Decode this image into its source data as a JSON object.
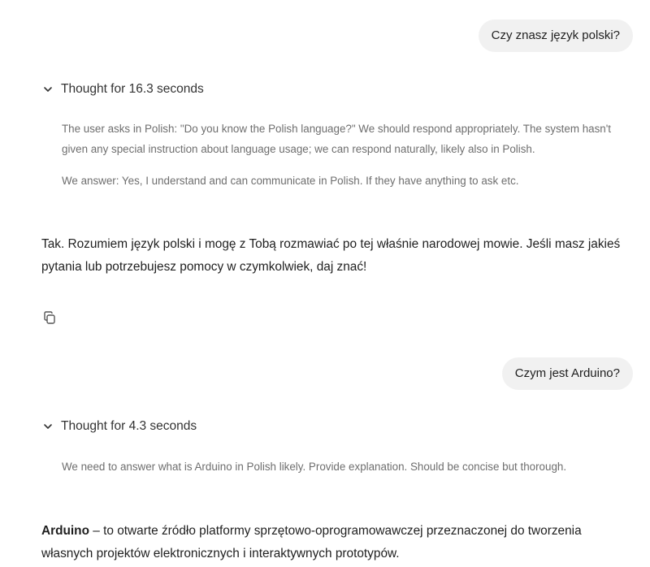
{
  "conversation": {
    "turn1": {
      "user_message": "Czy znasz język polski?",
      "thought_label": "Thought for 16.3 seconds",
      "thought_paragraphs": [
        "The user asks in Polish: \"Do you know the Polish language?\" We should respond appropriately. The system hasn't given any special instruction about language usage; we can respond naturally, likely also in Polish.",
        "We answer: Yes, I understand and can communicate in Polish. If they have anything to ask etc."
      ],
      "answer": "Tak. Rozumiem język polski i mogę z Tobą rozmawiać po tej właśnie narodowej mowie. Jeśli masz jakieś pytania lub potrzebujesz pomocy w czymkolwiek, daj znać!"
    },
    "turn2": {
      "user_message": "Czym jest Arduino?",
      "thought_label": "Thought for 4.3 seconds",
      "thought_paragraphs": [
        "We need to answer what is Arduino in Polish likely. Provide explanation. Should be concise but thorough."
      ],
      "answer_bold": "Arduino",
      "answer_rest": " – to otwarte źródło platformy sprzętowo-oprogramowawczej przeznaczonej do tworzenia własnych projektów elektronicznych i interaktywnych prototypów."
    }
  },
  "icons": {
    "thought_toggle": "chevron-down-icon",
    "copy": "copy-icon"
  },
  "colors": {
    "user_bubble_bg": "#f1f1f1",
    "thought_text": "#6e6e6e",
    "body_text": "#1f1f1f"
  }
}
